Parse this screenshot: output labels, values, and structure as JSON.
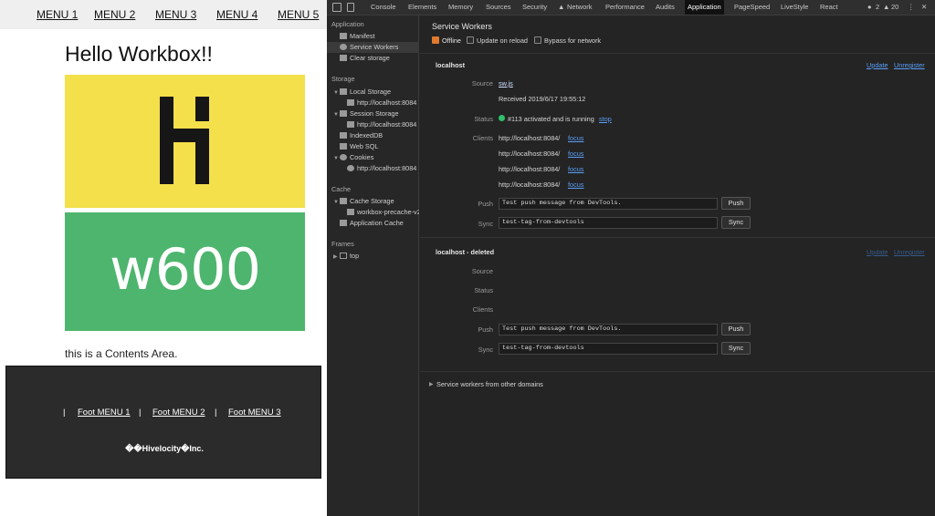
{
  "page": {
    "menu": [
      "MENU 1",
      "MENU 2",
      "MENU 3",
      "MENU 4",
      "MENU 5"
    ],
    "heading": "Hello Workbox!!",
    "banner_text": "w600",
    "contents": "this is a Contents Area.",
    "footer": {
      "separator": "|",
      "links": [
        "Foot MENU 1",
        "Foot MENU 2",
        "Foot MENU 3"
      ],
      "copyright": "��Hivelocity�Inc."
    },
    "colors": {
      "logo_bg": "#f4e04b",
      "banner_bg": "#4db56d",
      "footer_bg": "#2b2b2b"
    }
  },
  "devtools": {
    "tabs": [
      "Console",
      "Elements",
      "Memory",
      "Sources",
      "Security",
      "Network",
      "Performance",
      "Audits",
      "Application",
      "PageSpeed",
      "LiveStyle",
      "React"
    ],
    "active_tab": "Application",
    "error_count": "2",
    "warning_count": "20",
    "sidebar": {
      "application_heading": "Application",
      "application_items": [
        "Manifest",
        "Service Workers",
        "Clear storage"
      ],
      "storage_heading": "Storage",
      "local_storage": "Local Storage",
      "local_storage_origin": "http://localhost:8084",
      "session_storage": "Session Storage",
      "session_storage_origin": "http://localhost:8084",
      "indexeddb": "IndexedDB",
      "websql": "Web SQL",
      "cookies": "Cookies",
      "cookies_origin": "http://localhost:8084",
      "cache_heading": "Cache",
      "cache_storage": "Cache Storage",
      "cache_entry": "workbox-precache-v2",
      "application_cache": "Application Cache",
      "frames_heading": "Frames",
      "frame_top": "top"
    },
    "main": {
      "title": "Service Workers",
      "offline_label": "Offline",
      "update_on_reload_label": "Update on reload",
      "bypass_label": "Bypass for network",
      "worker1": {
        "origin": "localhost",
        "update": "Update",
        "unregister": "Unregister",
        "source_label": "Source",
        "source": "sw.js",
        "received": "Received 2019/6/17 19:55:12",
        "status_label": "Status",
        "status": "#113 activated and is running",
        "stop": "stop",
        "clients_label": "Clients",
        "clients": [
          "http://localhost:8084/",
          "http://localhost:8084/",
          "http://localhost:8084/",
          "http://localhost:8084/"
        ],
        "focus": "focus",
        "push_label": "Push",
        "push_value": "Test push message from DevTools.",
        "push_button": "Push",
        "sync_label": "Sync",
        "sync_value": "test-tag-from-devtools",
        "sync_button": "Sync"
      },
      "worker2": {
        "origin": "localhost - deleted",
        "update": "Update",
        "unregister": "Unregister",
        "source_label": "Source",
        "status_label": "Status",
        "clients_label": "Clients",
        "push_label": "Push",
        "push_value": "Test push message from DevTools.",
        "push_button": "Push",
        "sync_label": "Sync",
        "sync_value": "test-tag-from-devtools",
        "sync_button": "Sync"
      },
      "other_domains": "Service workers from other domains"
    }
  }
}
